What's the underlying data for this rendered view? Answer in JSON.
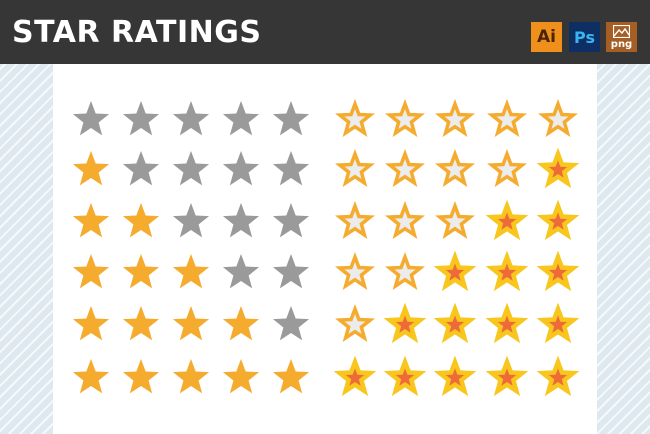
{
  "header": {
    "title": "STAR RATINGS"
  },
  "badges": {
    "ai": "Ai",
    "ps": "Ps",
    "png": "png"
  },
  "colors": {
    "header_bg": "#363636",
    "star_filled": "#f5ab2e",
    "star_empty": "#9a9a9a",
    "outline_stroke": "#f5ab2e",
    "outline_fill": "#ececec",
    "alt_stroke": "#f8c61d",
    "alt_fill": "#ef6a39"
  },
  "ratings": {
    "solid_set": {
      "max": 5,
      "rows": [
        0,
        1,
        2,
        3,
        4,
        5
      ]
    },
    "outline_set": {
      "max": 5,
      "rows": [
        0,
        1,
        2,
        3,
        4,
        5
      ]
    }
  }
}
